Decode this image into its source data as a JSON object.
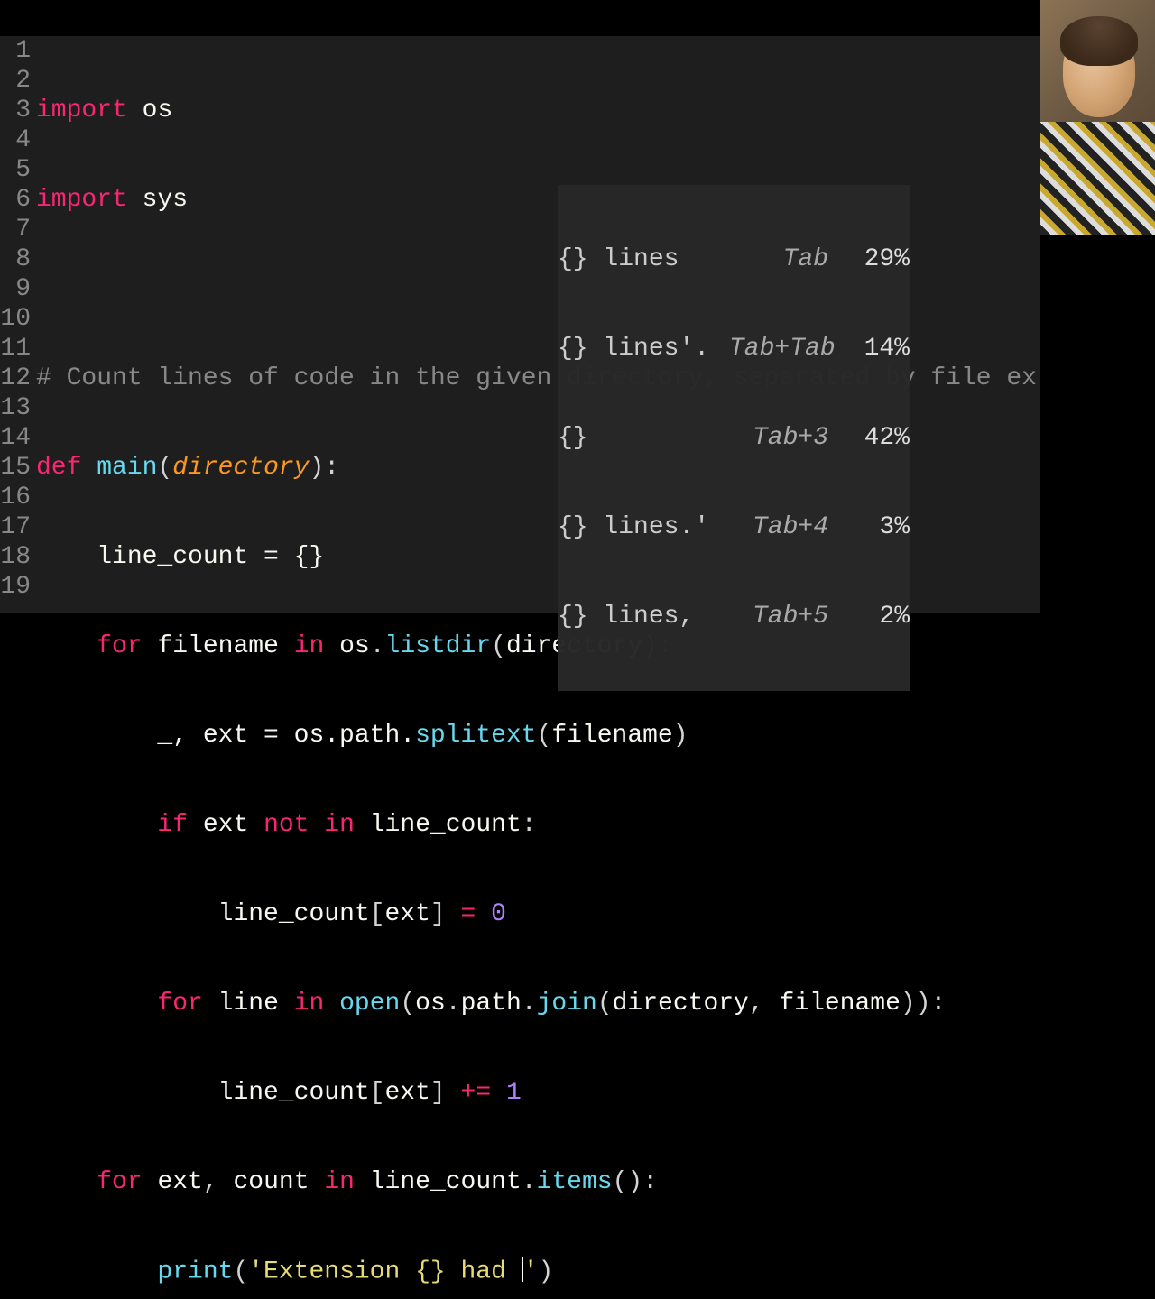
{
  "lines": [
    "1",
    "2",
    "3",
    "4",
    "5",
    "6",
    "7",
    "8",
    "9",
    "10",
    "11",
    "12",
    "13",
    "14",
    "15",
    "16",
    "17",
    "18",
    "19"
  ],
  "code": {
    "l1": {
      "import": "import",
      "os": "os"
    },
    "l2": {
      "import": "import",
      "sys": "sys"
    },
    "l4": {
      "comment": "# Count lines of code in the given directory, separated by file ex"
    },
    "l5": {
      "def": "def",
      "main": "main",
      "directory": "directory"
    },
    "l6": {
      "text": "    line_count = {}"
    },
    "l7": {
      "for": "for",
      "filename": "filename",
      "in": "in",
      "os": "os",
      "listdir": "listdir",
      "directory": "directory"
    },
    "l8": {
      "text": "        _, ext = os.path.",
      "splitext": "splitext",
      "filename": "filename"
    },
    "l9": {
      "if": "if",
      "ext": "ext",
      "notin": "not in",
      "lc": "line_count"
    },
    "l10": {
      "lc": "line_count",
      "ext": "ext",
      "eq": "=",
      "zero": "0"
    },
    "l11": {
      "for": "for",
      "line": "line",
      "in": "in",
      "open": "open",
      "os": "os",
      "path": "path",
      "join": "join",
      "directory": "directory",
      "filename": "filename"
    },
    "l12": {
      "lc": "line_count",
      "ext": "ext",
      "pluseq": "+=",
      "one": "1"
    },
    "l13": {
      "for": "for",
      "ext": "ext",
      "count": "count",
      "in": "in",
      "lc": "line_count",
      "items": "items"
    },
    "l14": {
      "print": "print",
      "str": "'Extension {} had "
    }
  },
  "suggestions": [
    {
      "text": "{} lines",
      "key": "Tab",
      "pct": "29%"
    },
    {
      "text": "{} lines'.",
      "key": "Tab+Tab",
      "pct": "14%"
    },
    {
      "text": "{}",
      "key": "Tab+3",
      "pct": "42%"
    },
    {
      "text": "{} lines.'",
      "key": "Tab+4",
      "pct": "3%"
    },
    {
      "text": "{} lines,",
      "key": "Tab+5",
      "pct": "2%"
    }
  ]
}
